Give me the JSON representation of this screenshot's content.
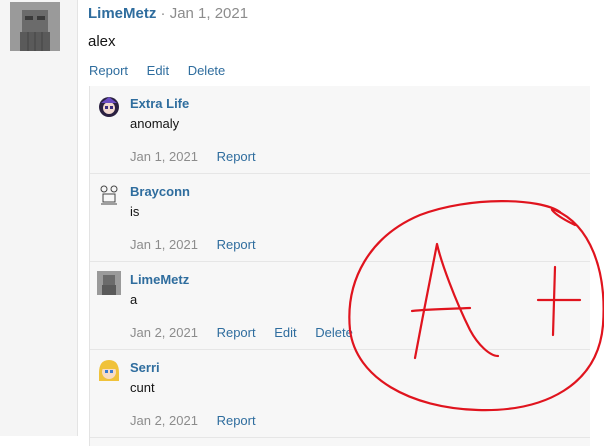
{
  "main_comment": {
    "author": "LimeMetz",
    "separator": "·",
    "date": "Jan 1, 2021",
    "body": "alex",
    "actions": {
      "report": "Report",
      "edit": "Edit",
      "delete": "Delete"
    }
  },
  "replies": [
    {
      "author": "Extra Life",
      "body": "anomaly",
      "date": "Jan 1, 2021",
      "report": "Report"
    },
    {
      "author": "Brayconn",
      "body": "is",
      "date": "Jan 1, 2021",
      "report": "Report"
    },
    {
      "author": "LimeMetz",
      "body": "a",
      "date": "Jan 2, 2021",
      "report": "Report",
      "edit": "Edit",
      "delete": "Delete"
    },
    {
      "author": "Serri",
      "body": "cunt",
      "date": "Jan 2, 2021",
      "report": "Report"
    }
  ],
  "annotation": {
    "text": "A+",
    "color": "#e0141e"
  },
  "colors": {
    "link": "#2f6d9e",
    "muted": "#8c8c8c",
    "panel": "#f7f7f7"
  }
}
